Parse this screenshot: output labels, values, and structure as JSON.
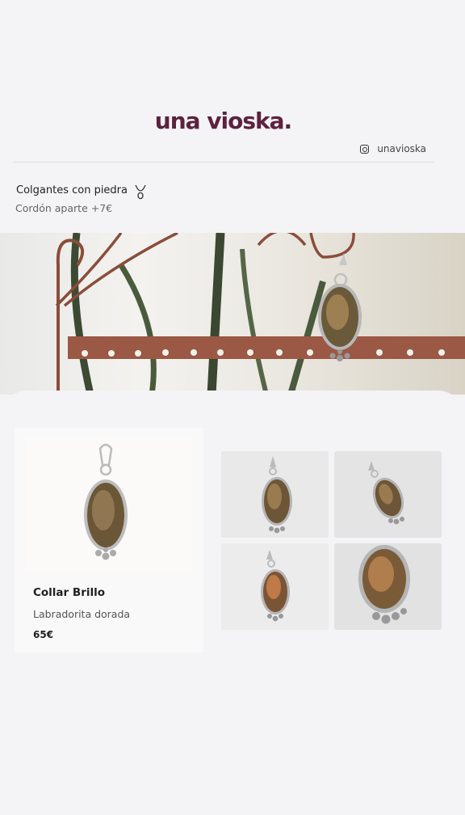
{
  "header": {
    "brand": "una vioska.",
    "social_handle": "unavioska",
    "social_icon": "instagram-icon"
  },
  "category": {
    "title": "Colgantes con piedra",
    "subtitle": "Cordón aparte +7€",
    "icon": "necklace-icon"
  },
  "product": {
    "name": "Collar Brillo",
    "description": "Labradorita dorada",
    "price": "65€"
  },
  "colors": {
    "brand": "#5e2140",
    "background": "#f4f4f6"
  }
}
